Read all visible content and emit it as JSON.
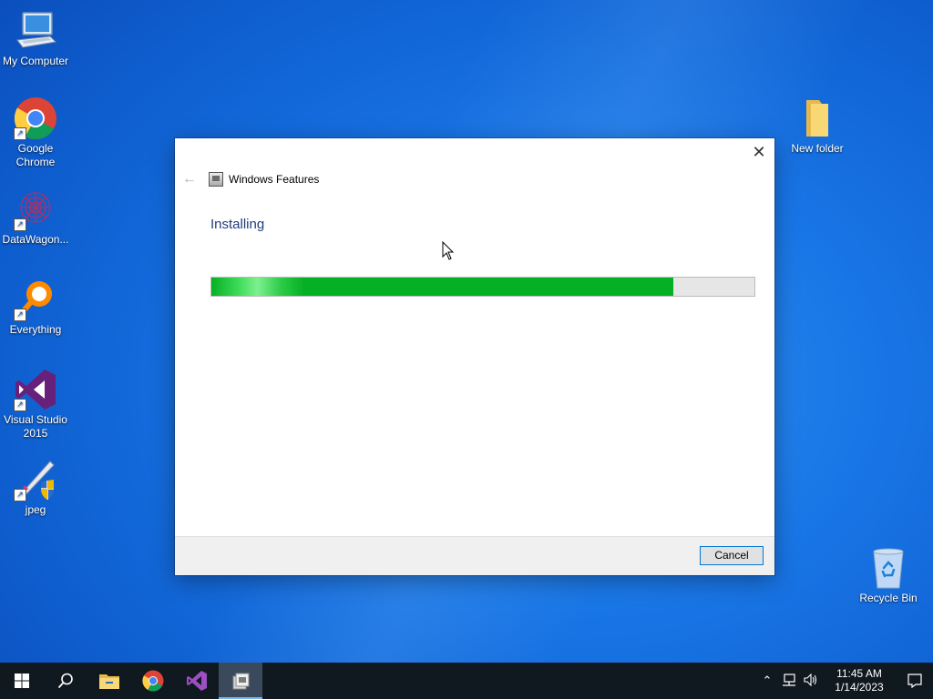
{
  "desktop": {
    "icons": [
      {
        "label": "My Computer",
        "icon": "computer-icon"
      },
      {
        "label": "Google Chrome",
        "icon": "chrome-icon"
      },
      {
        "label": "DataWagon...",
        "icon": "datawagon-icon"
      },
      {
        "label": "Everything",
        "icon": "everything-search-icon"
      },
      {
        "label": "Visual Studio 2015",
        "icon": "visual-studio-icon"
      },
      {
        "label": "jpeg",
        "icon": "jpeg-file-icon"
      },
      {
        "label": "New folder",
        "icon": "folder-icon"
      },
      {
        "label": "Recycle Bin",
        "icon": "recycle-bin-icon"
      }
    ]
  },
  "dialog": {
    "title": "Windows Features",
    "status": "Installing",
    "progress_fraction": 0.85,
    "cancel_label": "Cancel",
    "close_glyph": "✕",
    "back_glyph": "←"
  },
  "taskbar": {
    "items": [
      "start-icon",
      "search-icon",
      "file-explorer-icon",
      "chrome-icon",
      "visual-studio-icon",
      "windows-features-icon"
    ],
    "active_item": "windows-features-icon",
    "time": "11:45 AM",
    "date": "1/14/2023"
  },
  "colors": {
    "progress_green": "#06b025",
    "accent": "#0078d7",
    "desktop_blue": "#1976e6",
    "taskbar": "#101820"
  }
}
